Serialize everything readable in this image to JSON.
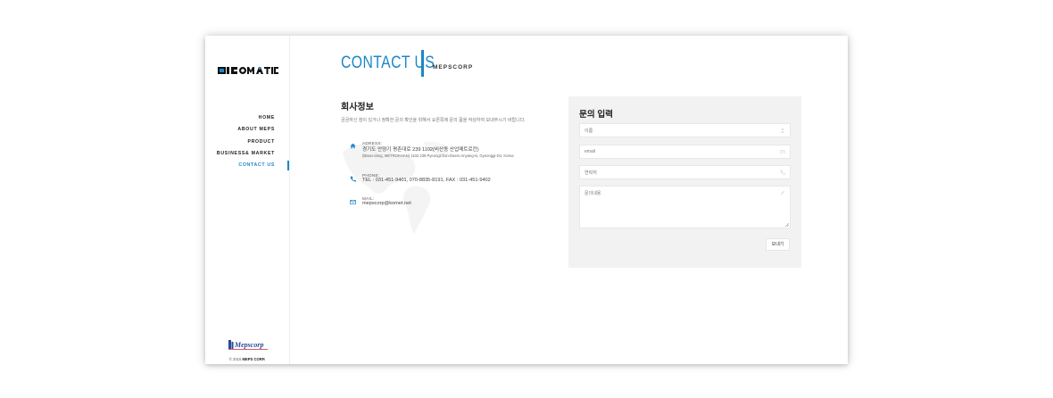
{
  "brand": {
    "logo_text": "MICOMATIC",
    "accent": "#1b86c8"
  },
  "nav": {
    "items": [
      {
        "label": "HOME"
      },
      {
        "label": "ABOUT MEPS"
      },
      {
        "label": "PRODUCT"
      },
      {
        "label": "BUSINESS& MARKET"
      },
      {
        "label": "CONTACT US"
      }
    ],
    "active": "CONTACT US"
  },
  "footer": {
    "copyright_prefix": "© 2015 ",
    "copyright_company": "MEPS CORP.",
    "mini_logo_text": "Mepscorp"
  },
  "page": {
    "title": "CONTACT US",
    "subtitle": "MEPSCORP"
  },
  "company_info": {
    "heading": "회사정보",
    "description": "궁금하신 점이 있거나 정확한 문의 확인을 위해서 요른쪽에 문의 폼을 작성하여 보내주시기 바랍니다.",
    "address_label": "ADRESS:",
    "address_kr": "경기도 안양기 평촌대로 239 1102(비산동 산업메트로칸)",
    "address_en": "(Bisan-dong, METROKHAN) 1102 239 PyeongChon-Daero Anyang-si, Gyeonggi-Do, Korea",
    "phone_label": "PHONE:",
    "phone_value": "TEL : 031-451-9401, 070-8835-8191, FAX : 031-451-9402",
    "mail_label": "MAIL:",
    "mail_value": "mepscorp@komet.net"
  },
  "form": {
    "heading": "문의 입력",
    "name_placeholder": "이름",
    "email_placeholder": "email",
    "phone_placeholder": "연락처",
    "message_placeholder": "문의내용",
    "send_label": "보내기"
  }
}
